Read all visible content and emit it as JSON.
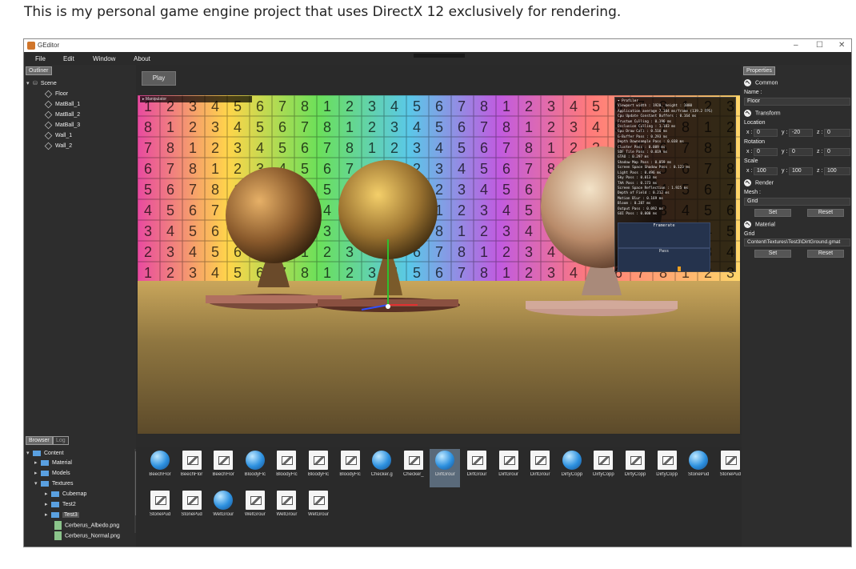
{
  "caption": "This is my personal game engine project that uses DirectX 12 exclusively for rendering.",
  "window": {
    "title": "GEditor",
    "minimize": "–",
    "maximize": "☐",
    "close": "✕"
  },
  "menu": [
    "File",
    "Edit",
    "Window",
    "About"
  ],
  "outliner": {
    "tab": "Outliner",
    "root": "Scene",
    "items": [
      "Floor",
      "MatBall_1",
      "MatBall_2",
      "MatBall_3",
      "Wall_1",
      "Wall_2"
    ]
  },
  "viewport": {
    "play": "Play",
    "manipulator": "▸ Manipulator",
    "profiler": {
      "title": "▾ Profiler",
      "lines": [
        "Viewport width : 1920, height : 1080",
        "Application average 7.104 ms/frame (139.2 FPS)",
        "Cpu Update Constant Buffers : 0.164 ms",
        "Frustum Culling : 0.196 ms",
        "Occlusion Culling : 1.183 ms",
        "Gpu Draw Call : 0.516 ms",
        "G-Buffer Pass : 0.293 ms",
        "Depth Downsample Pass : 0.038 ms",
        "Cluster Pass : 0.009 ms",
        "SDF Tile Pass : 0.019 ms",
        "GTAO : 0.297 ms",
        "Shadow Map Pass : 0.059 ms",
        "Screen Space Shadow Pass : 0.123 ms",
        "Light Pass : 0.496 ms",
        "Sky Pass : 0.013 ms",
        "TAA Pass : 0.173 ms",
        "Screen Space Reflection : 1.925 ms",
        "Depth of Field : 0.212 ms",
        "Motion Blur : 0.169 ms",
        "Bloom : 0.287 ms",
        "Output Pass : 0.092 ms",
        "GUI Pass : 0.000 ms"
      ],
      "framerate": "Framerate",
      "pass": "Pass"
    }
  },
  "properties": {
    "tab": "Properties",
    "common": "Common",
    "name_label": "Name :",
    "name_value": "Floor",
    "transform": "Transform",
    "location": "Location",
    "loc": {
      "x": "0",
      "y": "-20",
      "z": "0"
    },
    "rotation": "Rotation",
    "rot": {
      "x": "0",
      "y": "0",
      "z": "0"
    },
    "scale": "Scale",
    "scl": {
      "x": "100",
      "y": "100",
      "z": "100"
    },
    "render": "Render",
    "mesh_label": "Mesh :",
    "mesh_value": "Grid",
    "set": "Set",
    "reset": "Reset",
    "material": "Material",
    "grid_label": "Grid",
    "material_value": "Content\\Textures\\Test3\\DirtGround.gmat"
  },
  "browser": {
    "tabs": [
      "Browser",
      "Log"
    ],
    "tree": {
      "root": "Content",
      "folders": [
        "Material",
        "Models",
        "Textures",
        "Cubemap",
        "Test2",
        "Test3"
      ],
      "files": [
        "Cerberus_Albedo.png",
        "Cerberus_Normal.png"
      ]
    }
  },
  "assets": [
    {
      "label": "BeechFlor",
      "icon": "sphere"
    },
    {
      "label": "BeechFlor",
      "icon": "image"
    },
    {
      "label": "BeechFlor",
      "icon": "image"
    },
    {
      "label": "BloodyFlc",
      "icon": "sphere"
    },
    {
      "label": "BloodyFlc",
      "icon": "image"
    },
    {
      "label": "BloodyFlc",
      "icon": "image"
    },
    {
      "label": "BloodyFlc",
      "icon": "image"
    },
    {
      "label": "Checker.g",
      "icon": "sphere"
    },
    {
      "label": "Checker_",
      "icon": "image"
    },
    {
      "label": "DirtGrour",
      "icon": "sphere",
      "selected": true
    },
    {
      "label": "DirtGrour",
      "icon": "image"
    },
    {
      "label": "DirtGrour",
      "icon": "image"
    },
    {
      "label": "DirtGrour",
      "icon": "image"
    },
    {
      "label": "DirtyCopp",
      "icon": "sphere"
    },
    {
      "label": "DirtyCopp",
      "icon": "image"
    },
    {
      "label": "DirtyCopp",
      "icon": "image"
    },
    {
      "label": "DirtyCopp",
      "icon": "image"
    },
    {
      "label": "StonePud",
      "icon": "sphere"
    },
    {
      "label": "StonePud",
      "icon": "image"
    },
    {
      "label": "StonePud",
      "icon": "image"
    },
    {
      "label": "StonePud",
      "icon": "image"
    },
    {
      "label": "WetGrour",
      "icon": "sphere"
    },
    {
      "label": "WetGrour",
      "icon": "image"
    },
    {
      "label": "WetGrour",
      "icon": "image"
    },
    {
      "label": "WetGrour",
      "icon": "image"
    }
  ],
  "wall_digits": [
    "1",
    "2",
    "3",
    "4",
    "5",
    "6",
    "7",
    "8"
  ]
}
